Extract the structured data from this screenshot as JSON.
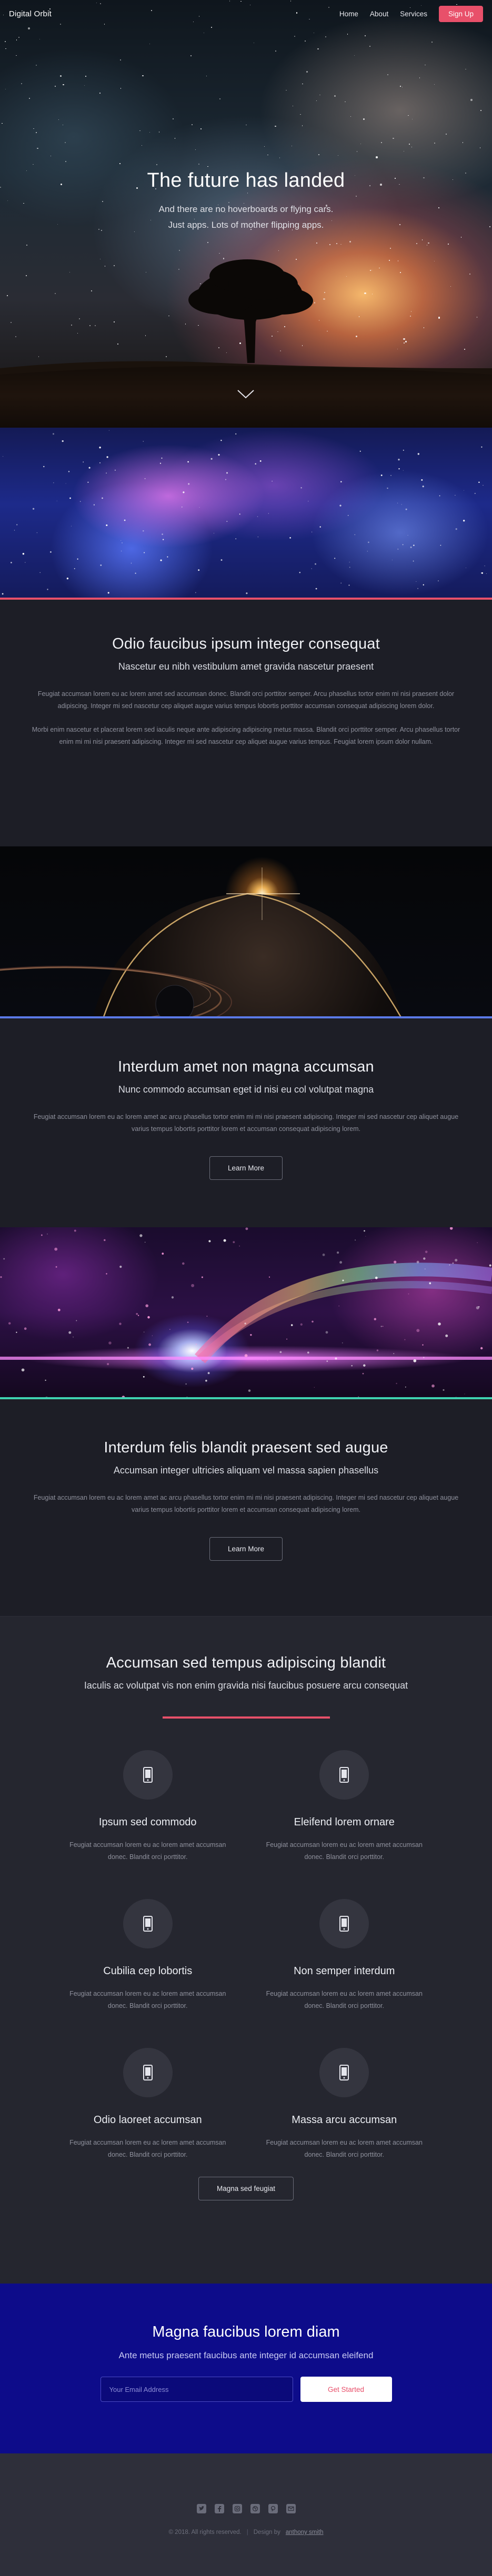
{
  "nav": {
    "logo": "Digital Orbit",
    "links": [
      "Home",
      "About",
      "Services"
    ],
    "signup": "Sign Up"
  },
  "hero": {
    "title": "The future has landed",
    "subtitle_line1": "And there are no hoverboards or flying cars.",
    "subtitle_line2": "Just apps. Lots of mother flipping apps."
  },
  "section1": {
    "title": "Odio faucibus ipsum integer consequat",
    "subtitle": "Nascetur eu nibh vestibulum amet gravida nascetur praesent",
    "para1": "Feugiat accumsan lorem eu ac lorem amet sed accumsan donec. Blandit orci porttitor semper. Arcu phasellus tortor enim mi nisi praesent dolor adipiscing. Integer mi sed nascetur cep aliquet augue varius tempus lobortis porttitor accumsan consequat adipiscing lorem dolor.",
    "para2": "Morbi enim nascetur et placerat lorem sed iaculis neque ante adipiscing adipiscing metus massa. Blandit orci porttitor semper. Arcu phasellus tortor enim mi mi nisi praesent adipiscing. Integer mi sed nascetur cep aliquet augue varius tempus. Feugiat lorem ipsum dolor nullam."
  },
  "section2": {
    "title": "Interdum amet non magna accumsan",
    "subtitle": "Nunc commodo accumsan eget id nisi eu col volutpat magna",
    "para": "Feugiat accumsan lorem eu ac lorem amet ac arcu phasellus tortor enim mi mi nisi praesent adipiscing. Integer mi sed nascetur cep aliquet augue varius tempus lobortis porttitor lorem et accumsan consequat adipiscing lorem.",
    "button": "Learn More"
  },
  "section3": {
    "title": "Interdum felis blandit praesent sed augue",
    "subtitle": "Accumsan integer ultricies aliquam vel massa sapien phasellus",
    "para": "Feugiat accumsan lorem eu ac lorem amet ac arcu phasellus tortor enim mi mi nisi praesent adipiscing. Integer mi sed nascetur cep aliquet augue varius tempus lobortis porttitor lorem et accumsan consequat adipiscing lorem.",
    "button": "Learn More"
  },
  "features": {
    "title": "Accumsan sed tempus adipiscing blandit",
    "subtitle": "Iaculis ac volutpat vis non enim gravida nisi faucibus posuere arcu consequat",
    "items": [
      {
        "title": "Ipsum sed commodo",
        "text": "Feugiat accumsan lorem eu ac lorem amet accumsan donec. Blandit orci porttitor."
      },
      {
        "title": "Eleifend lorem ornare",
        "text": "Feugiat accumsan lorem eu ac lorem amet accumsan donec. Blandit orci porttitor."
      },
      {
        "title": "Cubilia cep lobortis",
        "text": "Feugiat accumsan lorem eu ac lorem amet accumsan donec. Blandit orci porttitor."
      },
      {
        "title": "Non semper interdum",
        "text": "Feugiat accumsan lorem eu ac lorem amet accumsan donec. Blandit orci porttitor."
      },
      {
        "title": "Odio laoreet accumsan",
        "text": "Feugiat accumsan lorem eu ac lorem amet accumsan donec. Blandit orci porttitor."
      },
      {
        "title": "Massa arcu accumsan",
        "text": "Feugiat accumsan lorem eu ac lorem amet accumsan donec. Blandit orci porttitor."
      }
    ],
    "button": "Magna sed feugiat"
  },
  "cta": {
    "title": "Magna faucibus lorem diam",
    "subtitle": "Ante metus praesent faucibus ante integer id accumsan eleifend",
    "email_placeholder": "Your Email Address",
    "button": "Get Started"
  },
  "footer": {
    "copyright": "© 2018. All rights reserved.",
    "separator": "|",
    "design_label": "Design by",
    "design_name": "anthony smith",
    "social_icons": [
      "twitter-icon",
      "facebook-icon",
      "instagram-icon",
      "dribbble-icon",
      "pinterest-icon",
      "email-icon"
    ]
  },
  "colors": {
    "accent": "#e8506a",
    "cta_bg": "#0d0c8a",
    "dark_bg": "#1d1e26"
  }
}
